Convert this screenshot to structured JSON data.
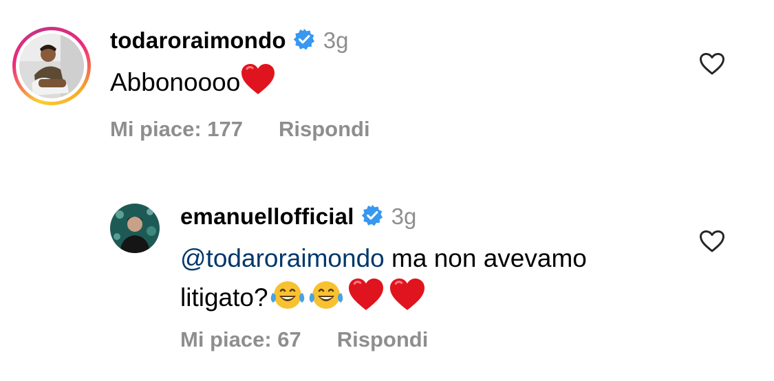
{
  "comments": [
    {
      "username": "todaroraimondo",
      "timestamp": "3g",
      "text": "Abbonoooo",
      "text_emojis": [
        "red-heart"
      ],
      "likes_label": "Mi piace: 177",
      "reply_label": "Rispondi",
      "has_story_ring": true
    },
    {
      "username": "emanuellofficial",
      "timestamp": "3g",
      "mention": "@todaroraimondo",
      "text_line1": "ma non avevamo",
      "text_line2": "litigato?",
      "text_emojis": [
        "tears-of-joy",
        "tears-of-joy",
        "red-heart",
        "red-heart"
      ],
      "likes_label": "Mi piace: 67",
      "reply_label": "Rispondi",
      "has_story_ring": false
    }
  ],
  "colors": {
    "verified": "#3897f0",
    "secondary_text": "#8e8e8e",
    "mention": "#00376b",
    "heart": "#e0141e"
  }
}
